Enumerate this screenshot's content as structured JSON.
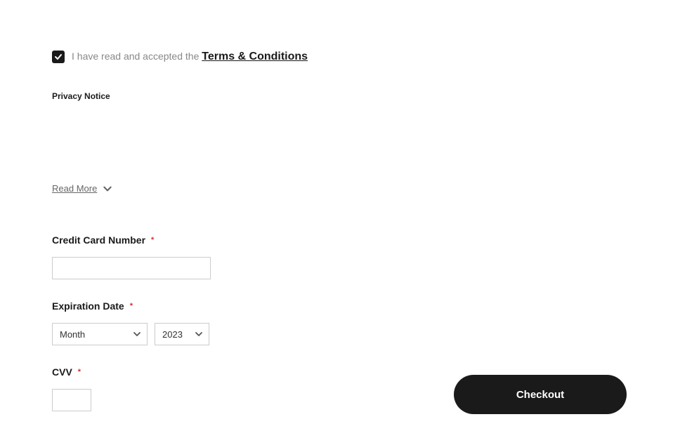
{
  "terms": {
    "checkbox_checked": true,
    "prefix_text": "I have read and accepted the ",
    "link_text": "Terms & Conditions"
  },
  "privacy": {
    "heading": "Privacy Notice",
    "read_more_label": "Read More"
  },
  "payment": {
    "cc_label": "Credit Card Number",
    "cc_value": "",
    "exp_label": "Expiration Date",
    "month_value": "Month",
    "year_value": "2023",
    "cvv_label": "CVV",
    "cvv_value": ""
  },
  "actions": {
    "checkout_label": "Checkout"
  }
}
